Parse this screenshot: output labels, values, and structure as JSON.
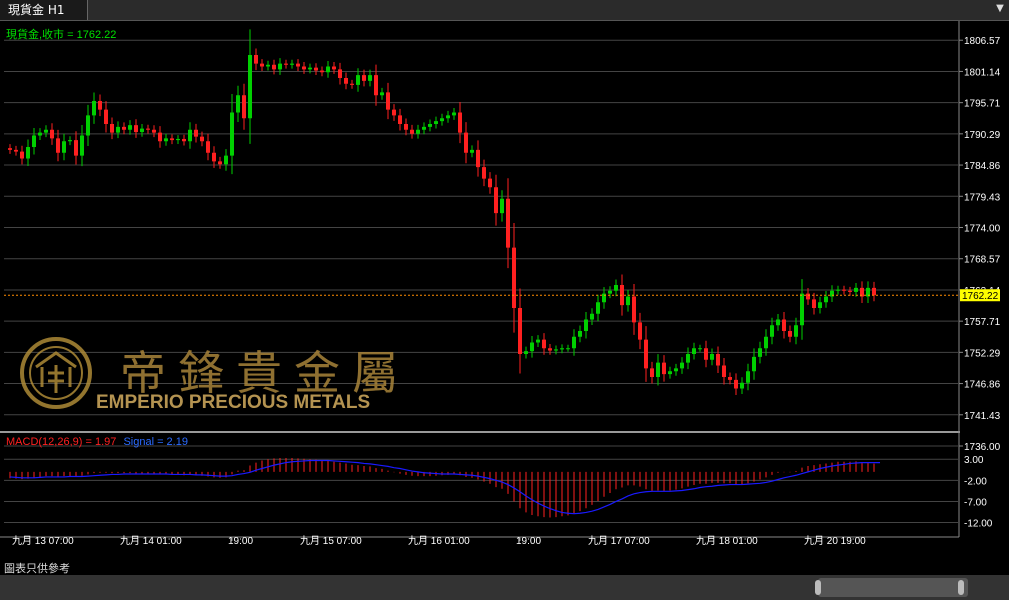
{
  "window": {
    "tab_title": "現貨金 H1",
    "menu_icon": "dropdown-arrow-icon"
  },
  "colors": {
    "up": "#00d000",
    "down": "#ff2020",
    "macd_hist": "#ff2020",
    "signal": "#1a1aff",
    "grid": "#444444",
    "axis_text": "#ffffff",
    "price_line": "#ff8c00",
    "label_green": "#00e000",
    "label_red": "#ff2020",
    "label_blue": "#2b6bff",
    "current_bg": "#ffff00"
  },
  "price_legend": "現貨金,收市 = 1762.22",
  "current_price_tag": "1762.22",
  "macd_legend": {
    "main": "MACD(12,26,9) = 1.97",
    "signal": "Signal = 2.19"
  },
  "watermark": {
    "chinese": "帝鋒貴金屬",
    "english": "EMPERIO PRECIOUS METALS"
  },
  "footer_note": "圖表只供參考",
  "chart_data": {
    "type": "candlestick",
    "price_axis_ticks": [
      "1806.57",
      "1801.14",
      "1795.71",
      "1790.29",
      "1784.86",
      "1779.43",
      "1774.00",
      "1768.57",
      "1763.14",
      "1757.71",
      "1752.29",
      "1746.86",
      "1741.43",
      "1736.00"
    ],
    "macd_axis_ticks": [
      "3.00",
      "-2.00",
      "-7.00",
      "-12.00"
    ],
    "ylim_price": [
      1736.0,
      1808.0
    ],
    "ylim_macd": [
      -14.0,
      4.0
    ],
    "current_price": 1762.22,
    "x_tick_labels": [
      {
        "label": "九月 13 07:00",
        "bar": 1
      },
      {
        "label": "九月 14 01:00",
        "bar": 19
      },
      {
        "label": "19:00",
        "bar": 37
      },
      {
        "label": "九月 15 07:00",
        "bar": 49
      },
      {
        "label": "九月 16 01:00",
        "bar": 67
      },
      {
        "label": "19:00",
        "bar": 85
      },
      {
        "label": "九月 17 07:00",
        "bar": 97
      },
      {
        "label": "九月 18 01:00",
        "bar": 115
      },
      {
        "label": "九月 20 19:00",
        "bar": 133
      }
    ],
    "closes": [
      1787.5,
      1787.2,
      1786.0,
      1788.0,
      1790.0,
      1790.5,
      1791.0,
      1789.5,
      1787.0,
      1789.0,
      1789.2,
      1786.5,
      1790.0,
      1793.5,
      1796.0,
      1794.5,
      1792.0,
      1790.5,
      1791.5,
      1791.0,
      1791.8,
      1790.6,
      1791.2,
      1791.0,
      1790.5,
      1789.0,
      1789.5,
      1789.2,
      1789.4,
      1789.0,
      1791.0,
      1789.8,
      1789.0,
      1787.0,
      1785.5,
      1785.0,
      1786.5,
      1794.0,
      1797.0,
      1793.0,
      1804.0,
      1802.5,
      1802.0,
      1802.3,
      1801.5,
      1802.5,
      1802.3,
      1802.5,
      1802.0,
      1801.5,
      1801.8,
      1801.3,
      1801.0,
      1802.0,
      1801.5,
      1800.0,
      1799.0,
      1798.8,
      1800.5,
      1799.5,
      1800.5,
      1797.0,
      1797.5,
      1794.5,
      1793.5,
      1792.0,
      1791.0,
      1790.3,
      1791.0,
      1791.5,
      1792.0,
      1792.5,
      1793.0,
      1793.5,
      1794.0,
      1790.5,
      1787.0,
      1787.5,
      1784.5,
      1782.5,
      1781.0,
      1776.5,
      1779.0,
      1770.5,
      1760.0,
      1752.0,
      1752.5,
      1754.0,
      1754.5,
      1753.0,
      1752.6,
      1752.8,
      1753.0,
      1753.0,
      1755.0,
      1756.0,
      1758.0,
      1759.0,
      1761.0,
      1762.5,
      1763.0,
      1764.0,
      1760.5,
      1762.0,
      1757.5,
      1754.5,
      1749.5,
      1748.0,
      1750.5,
      1748.5,
      1749.0,
      1749.5,
      1750.5,
      1752.0,
      1753.0,
      1753.0,
      1751.0,
      1752.0,
      1750.0,
      1748.0,
      1747.5,
      1746.0,
      1747.0,
      1749.0,
      1751.5,
      1753.0,
      1755.0,
      1757.0,
      1758.0,
      1756.0,
      1755.0,
      1757.0,
      1762.5,
      1761.5,
      1760.0,
      1761.0,
      1762.0,
      1763.0,
      1763.2,
      1763.0,
      1762.8,
      1763.5,
      1762.0,
      1763.5,
      1762.22
    ],
    "macd_histogram": [
      -1.5,
      -1.6,
      -1.7,
      -1.6,
      -1.4,
      -1.2,
      -1.0,
      -1.0,
      -1.1,
      -1.0,
      -1.0,
      -1.1,
      -0.9,
      -0.6,
      -0.3,
      -0.2,
      -0.2,
      -0.3,
      -0.3,
      -0.3,
      -0.3,
      -0.4,
      -0.4,
      -0.4,
      -0.5,
      -0.6,
      -0.6,
      -0.7,
      -0.7,
      -0.8,
      -0.7,
      -0.8,
      -0.9,
      -1.1,
      -1.3,
      -1.4,
      -1.3,
      -0.6,
      0.3,
      0.4,
      1.5,
      2.2,
      2.7,
      3.0,
      3.2,
      3.3,
      3.3,
      3.3,
      3.2,
      3.1,
      3.0,
      2.9,
      2.7,
      2.6,
      2.4,
      2.2,
      2.0,
      1.7,
      1.6,
      1.4,
      1.3,
      0.9,
      0.7,
      0.3,
      -0.1,
      -0.4,
      -0.7,
      -0.9,
      -1.0,
      -1.0,
      -1.0,
      -0.9,
      -0.8,
      -0.7,
      -0.6,
      -0.8,
      -1.2,
      -1.4,
      -1.8,
      -2.3,
      -2.8,
      -3.6,
      -4.0,
      -5.2,
      -7.0,
      -8.6,
      -9.6,
      -10.2,
      -10.5,
      -10.7,
      -10.8,
      -10.7,
      -10.5,
      -10.3,
      -9.8,
      -9.3,
      -8.6,
      -7.8,
      -6.9,
      -5.9,
      -5.0,
      -4.1,
      -3.7,
      -3.2,
      -3.2,
      -3.5,
      -4.1,
      -4.5,
      -4.4,
      -4.5,
      -4.4,
      -4.2,
      -3.9,
      -3.5,
      -3.1,
      -2.8,
      -2.8,
      -2.6,
      -2.6,
      -2.7,
      -2.7,
      -2.9,
      -2.9,
      -2.7,
      -2.3,
      -1.8,
      -1.3,
      -0.7,
      -0.2,
      -0.1,
      -0.1,
      0.2,
      1.0,
      1.4,
      1.6,
      1.8,
      2.0,
      2.2,
      2.4,
      2.4,
      2.4,
      2.5,
      2.3,
      2.3,
      1.97
    ],
    "signal_line": [
      -1.2,
      -1.3,
      -1.4,
      -1.4,
      -1.4,
      -1.3,
      -1.2,
      -1.2,
      -1.2,
      -1.2,
      -1.1,
      -1.1,
      -1.1,
      -1.0,
      -0.9,
      -0.8,
      -0.7,
      -0.6,
      -0.6,
      -0.5,
      -0.5,
      -0.5,
      -0.5,
      -0.5,
      -0.5,
      -0.5,
      -0.5,
      -0.6,
      -0.6,
      -0.6,
      -0.6,
      -0.7,
      -0.7,
      -0.8,
      -0.9,
      -1.0,
      -1.0,
      -0.9,
      -0.6,
      -0.4,
      -0.1,
      0.4,
      0.8,
      1.2,
      1.6,
      1.9,
      2.2,
      2.4,
      2.5,
      2.6,
      2.7,
      2.7,
      2.7,
      2.7,
      2.6,
      2.5,
      2.4,
      2.3,
      2.2,
      2.0,
      1.9,
      1.7,
      1.5,
      1.3,
      1.0,
      0.8,
      0.5,
      0.2,
      0.0,
      -0.2,
      -0.3,
      -0.4,
      -0.5,
      -0.5,
      -0.5,
      -0.6,
      -0.7,
      -0.8,
      -1.0,
      -1.3,
      -1.6,
      -2.0,
      -2.4,
      -3.0,
      -3.8,
      -4.7,
      -5.7,
      -6.6,
      -7.4,
      -8.1,
      -8.7,
      -9.2,
      -9.6,
      -9.8,
      -9.9,
      -9.8,
      -9.6,
      -9.3,
      -8.9,
      -8.3,
      -7.7,
      -7.0,
      -6.4,
      -5.7,
      -5.2,
      -4.9,
      -4.7,
      -4.6,
      -4.6,
      -4.6,
      -4.6,
      -4.5,
      -4.4,
      -4.2,
      -4.0,
      -3.7,
      -3.5,
      -3.4,
      -3.2,
      -3.1,
      -3.0,
      -3.0,
      -3.0,
      -2.9,
      -2.8,
      -2.7,
      -2.5,
      -2.2,
      -1.8,
      -1.4,
      -1.1,
      -0.8,
      -0.4,
      0.0,
      0.4,
      0.8,
      1.1,
      1.4,
      1.6,
      1.8,
      2.0,
      2.1,
      2.2,
      2.2,
      2.2,
      2.19
    ]
  }
}
